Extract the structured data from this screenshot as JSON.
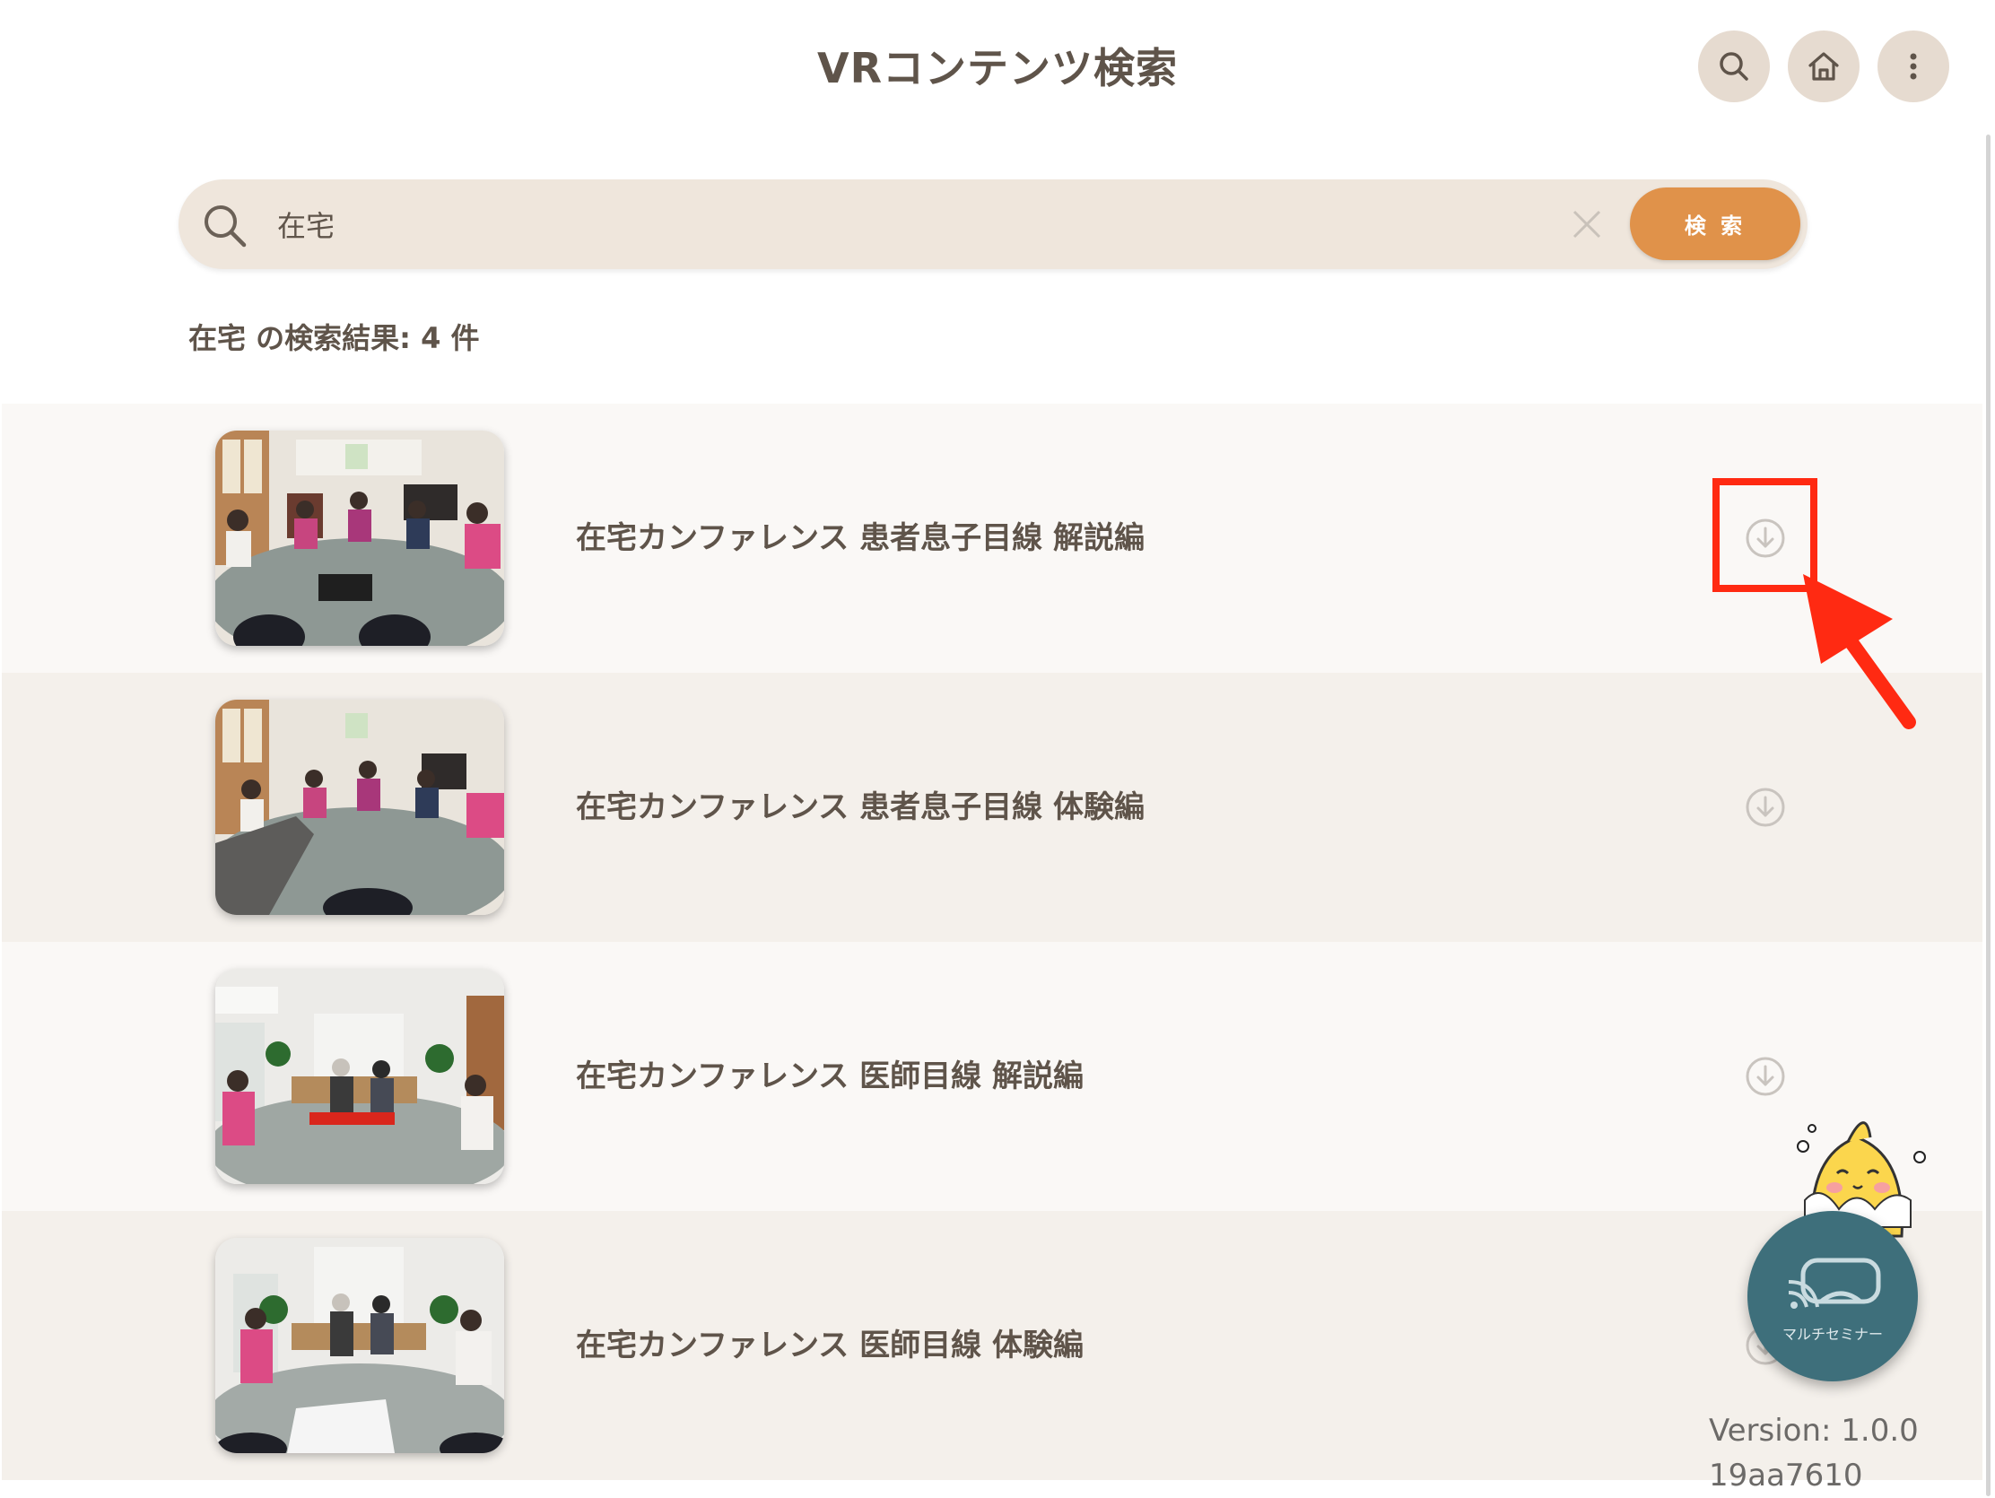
{
  "header": {
    "title": "VRコンテンツ検索",
    "buttons": [
      {
        "icon": "search-icon"
      },
      {
        "icon": "home-icon"
      },
      {
        "icon": "more-vertical-icon"
      }
    ]
  },
  "search": {
    "value": "在宅",
    "button_label": "検 索",
    "icon": "search-icon",
    "clear_icon": "close-icon"
  },
  "results": {
    "summary": "在宅 の検索結果: 4 件",
    "items": [
      {
        "title": "在宅カンファレンス 患者息子目線 解説編",
        "icon": "download-icon",
        "highlighted": true
      },
      {
        "title": "在宅カンファレンス 患者息子目線 体験編",
        "icon": "download-icon"
      },
      {
        "title": "在宅カンファレンス 医師目線 解説編",
        "icon": "download-icon"
      },
      {
        "title": "在宅カンファレンス 医師目線 体験編",
        "icon": "download-icon"
      }
    ]
  },
  "floating": {
    "multi_label": "マルチセミナー",
    "icon": "vr-headset-icon",
    "mascot": "mascot-character"
  },
  "footer": {
    "version": "Version: 1.0.0",
    "build": "19aa7610"
  },
  "colors": {
    "accent": "#e0924a",
    "header_button": "#e6dbd0",
    "search_bg": "#efe6dc",
    "text": "#5f544a",
    "highlight": "#ff2a12",
    "multi_button": "#3e6f7b"
  }
}
